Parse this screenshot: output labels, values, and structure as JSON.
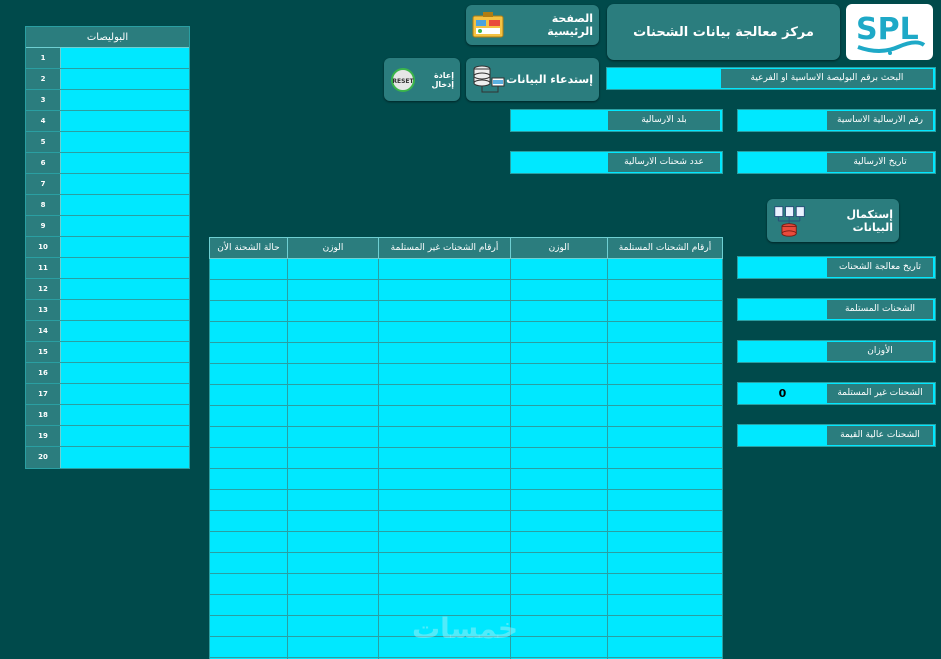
{
  "header": {
    "logo_text": "SPL",
    "title": "مركز معالجة بيانات الشحنات"
  },
  "buttons": {
    "home": "الصفحة الرئيسية",
    "fetch": "إستدعاء البيانات",
    "reset": "إعادة إدخال",
    "reset_icon_text": "RESET",
    "complete": "إستكمال البيانات"
  },
  "search": {
    "label": "البحث برقم البوليصة الاساسية او الفرعية",
    "value": ""
  },
  "fields": {
    "main_shipment_no": {
      "label": "رقم الارسالية الاساسية",
      "value": ""
    },
    "shipment_country": {
      "label": "بلد الارسالية",
      "value": ""
    },
    "shipment_date": {
      "label": "تاريخ الارسالية",
      "value": ""
    },
    "shipment_count": {
      "label": "عدد شحنات الارسالية",
      "value": ""
    },
    "processing_date": {
      "label": "تاريخ معالجة الشحنات",
      "value": ""
    },
    "received": {
      "label": "الشحنات المستلمة",
      "value": ""
    },
    "weights": {
      "label": "الأوزان",
      "value": ""
    },
    "not_received": {
      "label": "الشحنات غير المستلمة",
      "value": "0"
    },
    "high_value": {
      "label": "الشحنات عالية القيمة",
      "value": ""
    }
  },
  "policies": {
    "header": "البوليصات",
    "rows": [
      "1",
      "2",
      "3",
      "4",
      "5",
      "6",
      "7",
      "8",
      "9",
      "10",
      "11",
      "12",
      "13",
      "14",
      "15",
      "16",
      "17",
      "18",
      "19",
      "20"
    ]
  },
  "table": {
    "columns": [
      "أرقام الشحنات المستلمة",
      "الوزن",
      "أرقام الشحنات غير المستلمة",
      "الوزن",
      "حالة الشحنة الأن"
    ],
    "row_count": 20
  },
  "watermark": "خمسات",
  "colors": {
    "background": "#004a4b",
    "panel": "#2b7d7e",
    "cell": "#00e8ff"
  }
}
